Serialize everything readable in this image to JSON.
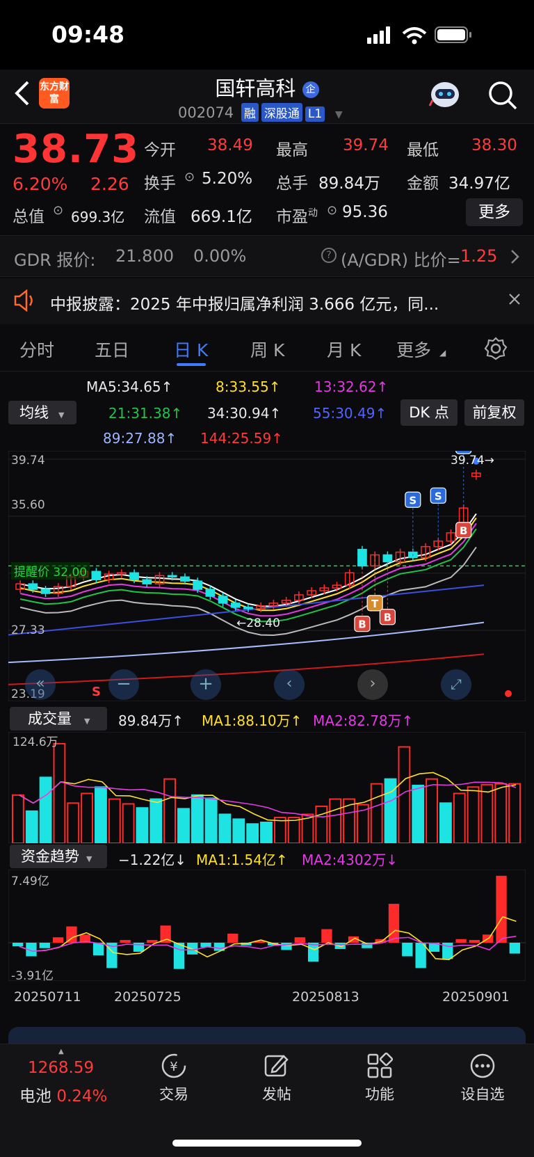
{
  "status": {
    "time": "09:48"
  },
  "header": {
    "logo": "东方财富",
    "stock_name": "国轩高科",
    "stock_code": "002074",
    "tags": [
      "融",
      "深股通",
      "L1"
    ]
  },
  "quote": {
    "price": "38.73",
    "change_pct": "6.20%",
    "change_amt": "2.26",
    "open_label": "今开",
    "open": "38.49",
    "high_label": "最高",
    "high": "39.74",
    "low_label": "最低",
    "low": "38.30",
    "turnover_label": "换手",
    "turnover": "5.20%",
    "volume_label": "总手",
    "volume": "89.84万",
    "amount_label": "金额",
    "amount": "34.97亿",
    "mktcap_label": "总值",
    "mktcap": "699.3亿",
    "float_label": "流值",
    "float": "669.1亿",
    "pe_label": "市盈",
    "pe_sup": "动",
    "pe": "95.36",
    "more_btn": "更多"
  },
  "gdr": {
    "label": "GDR 报价:",
    "price": "21.800",
    "pct": "0.00%",
    "ratio_label": "(A/GDR) 比价=",
    "ratio": "1.25"
  },
  "notice": {
    "text": "中报披露：2025 年中报归属净利润 3.666 亿元，同..."
  },
  "tabs": [
    "分时",
    "五日",
    "日 K",
    "周 K",
    "月 K",
    "更多"
  ],
  "ma": {
    "btn": "均线",
    "ma5": "MA5:34.65↑",
    "ma8": "8:33.55↑",
    "ma13": "13:32.62↑",
    "ma21": "21:31.38↑",
    "ma34": "34:30.94↑",
    "ma55": "55:30.49↑",
    "ma89": "89:27.88↑",
    "ma144": "144:25.59↑",
    "dk": "DK 点",
    "fq": "前复权"
  },
  "chart_data": [
    {
      "type": "candlestick",
      "y_ticks": [
        "39.74",
        "35.60",
        "27.33",
        "23.19"
      ],
      "ylim": [
        23.19,
        39.74
      ],
      "annotations": [
        "39.74→",
        "←28.40",
        "提醒价 32.00"
      ],
      "x_labels": [
        "20250711",
        "20250725",
        "20250813",
        "20250901"
      ],
      "markers": [
        "S",
        "S",
        "S",
        "B",
        "T",
        "B",
        "B",
        "S"
      ],
      "close": [
        30.7,
        30.3,
        30.0,
        30.5,
        31.2,
        31.6,
        31.0,
        31.4,
        31.5,
        31.0,
        30.7,
        31.3,
        31.2,
        30.9,
        30.3,
        29.8,
        29.3,
        29.0,
        28.9,
        29.1,
        29.3,
        29.5,
        29.9,
        30.2,
        30.4,
        30.6,
        31.5,
        32.0,
        32.8,
        32.3,
        33.0,
        32.6,
        33.4,
        33.8,
        34.4,
        36.2,
        38.73
      ],
      "open": [
        30.3,
        30.7,
        30.3,
        30.0,
        30.5,
        31.2,
        31.6,
        31.0,
        31.4,
        31.5,
        31.0,
        30.7,
        31.3,
        31.2,
        30.9,
        30.3,
        29.8,
        29.3,
        29.0,
        28.9,
        29.1,
        29.3,
        29.5,
        29.9,
        30.2,
        30.4,
        30.6,
        33.2,
        32.0,
        32.8,
        32.3,
        33.0,
        32.6,
        33.4,
        33.8,
        34.4,
        38.49
      ]
    },
    {
      "type": "bar",
      "title": "成交量",
      "header": [
        "89.84万↑",
        "MA1:88.10万↑",
        "MA2:82.78万↑"
      ],
      "y_max_label": "124.6万",
      "values": [
        60,
        40,
        82,
        124,
        50,
        62,
        70,
        55,
        49,
        44,
        55,
        80,
        43,
        60,
        56,
        36,
        30,
        24,
        26,
        32,
        32,
        36,
        46,
        55,
        55,
        48,
        74,
        80,
        120,
        72,
        80,
        50,
        62,
        70,
        73,
        74,
        74
      ],
      "colors_up": "#ff2b2b",
      "colors_down": "#1de3e3"
    },
    {
      "type": "bar",
      "title": "资金趋势",
      "header": [
        "−1.22亿↓",
        "MA1:1.54亿↑",
        "MA2:4302万↓"
      ],
      "y_labels": [
        "7.49亿",
        "-3.91亿"
      ],
      "values": [
        -0.4,
        -1.5,
        -0.6,
        0.6,
        1.8,
        0.9,
        -1.4,
        -2.8,
        0.3,
        -1.0,
        0.3,
        1.9,
        -2.9,
        -1.3,
        -0.5,
        -0.9,
        1.0,
        -0.3,
        0.2,
        -0.3,
        -0.8,
        0.6,
        -2.1,
        1.5,
        -0.7,
        0.7,
        -0.6,
        0.4,
        4.3,
        -1.5,
        -2.8,
        -1.0,
        -1.8,
        0.4,
        0.3,
        0.9,
        7.4,
        -1.2
      ]
    }
  ],
  "chart_controls": {
    "s_mark": "S"
  },
  "nav": {
    "index_val": "1268.59",
    "index_name": "电池",
    "index_pct": "0.24%",
    "trade": "交易",
    "post": "发帖",
    "func": "功能",
    "watch": "设自选"
  }
}
